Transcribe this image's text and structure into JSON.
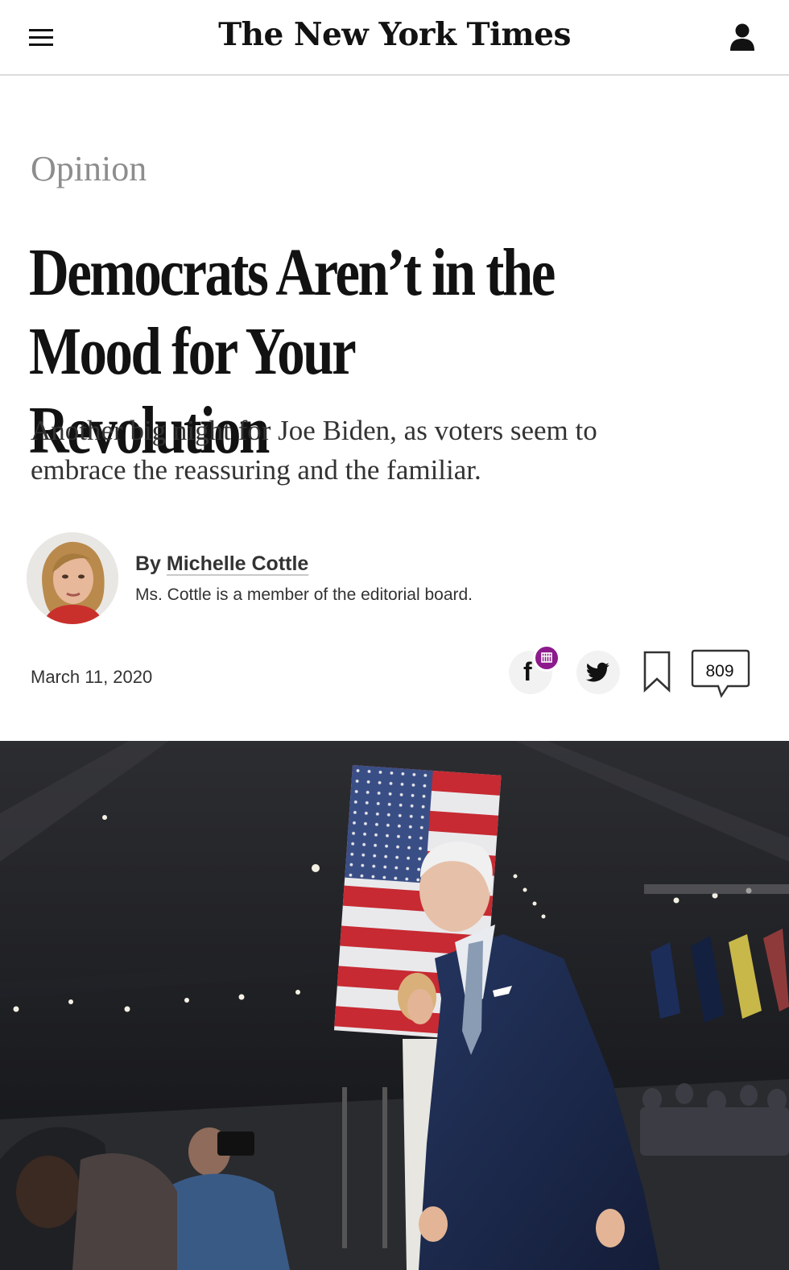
{
  "header": {
    "logo_text": "The New York Times",
    "menu_icon": "hamburger-menu-icon",
    "account_icon": "user-account-icon"
  },
  "article": {
    "section": "Opinion",
    "headline": "Democrats Aren’t in the Mood for Your Revolution",
    "summary": "Another big night for Joe Biden, as voters seem to embrace the reassuring and the familiar.",
    "byline_prefix": "By ",
    "author": "Michelle Cottle",
    "author_bio": "Ms. Cottle is a member of the editorial board.",
    "date": "March 11, 2020"
  },
  "share": {
    "facebook_icon": "facebook-icon",
    "twitter_icon": "twitter-icon",
    "gift_icon": "gift-icon",
    "bookmark_icon": "bookmark-icon",
    "comment_icon": "comment-bubble-icon",
    "comment_count": "809"
  },
  "colors": {
    "text": "#121212",
    "section_gray": "#8d8d8d",
    "gift_badge": "#8c1a8c",
    "share_bg": "#f2f2f2"
  }
}
